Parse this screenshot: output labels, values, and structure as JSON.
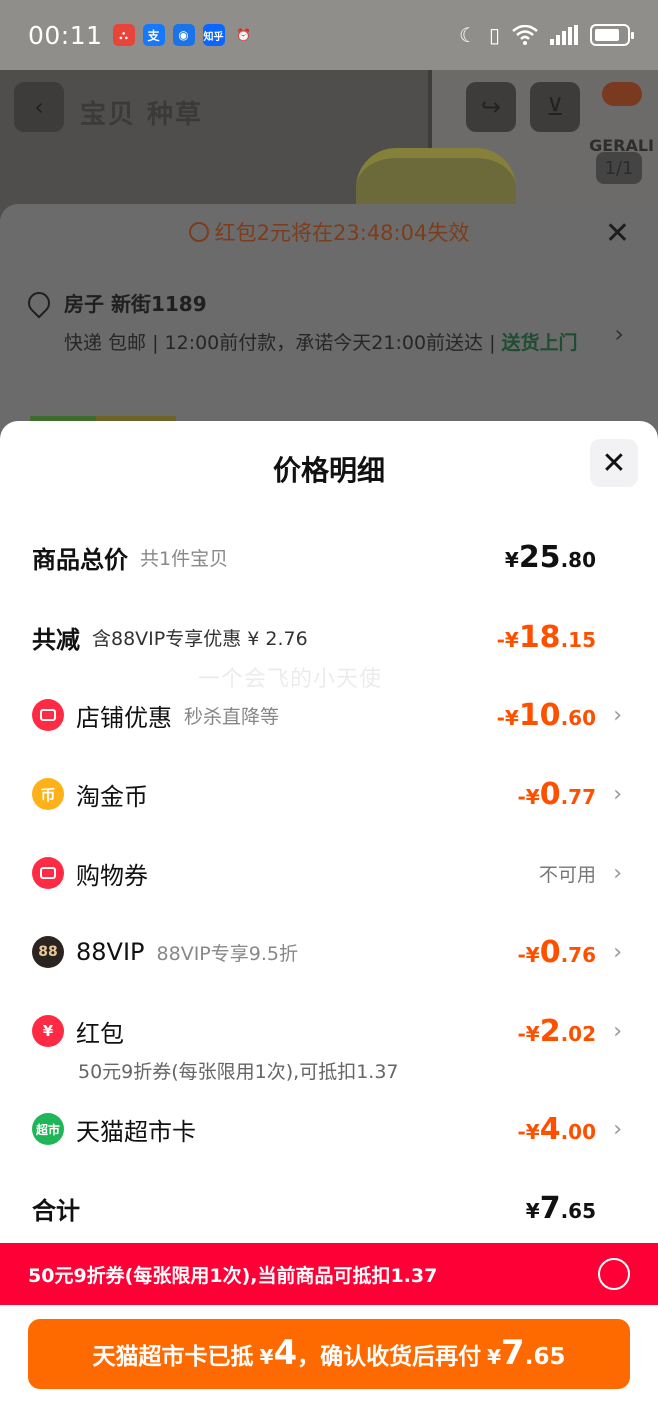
{
  "status_bar": {
    "time": "00:11",
    "apps": [
      {
        "name": "app-icon-1",
        "glyph": "⛬",
        "color": "#e8443a"
      },
      {
        "name": "alipay-icon",
        "glyph": "支",
        "color": "#1677ff"
      },
      {
        "name": "app-icon-3",
        "glyph": "◉",
        "color": "#1a73e8"
      },
      {
        "name": "zhihu-icon",
        "glyph": "知乎",
        "color": "#0a66ff"
      },
      {
        "name": "alarm-icon",
        "glyph": "⏰",
        "color": "transparent"
      }
    ]
  },
  "product_header": {
    "tabs": "宝贝 种草",
    "brand": "GERALI",
    "image_count": "1/1"
  },
  "order_sheet": {
    "banner": "红包2元将在23:48:04失效",
    "address": "房子 新街1189",
    "delivery_prefix": "快递 包邮 | 12:00前付款，承诺今天21:00前送达 | ",
    "delivery_highlight": "送货上门"
  },
  "price_panel": {
    "title": "价格明细",
    "watermark": "一个会飞的小天使",
    "total": {
      "label": "商品总价",
      "sub": "共1件宝贝",
      "cur": "¥",
      "int": "25",
      "dec": ".80"
    },
    "reduction": {
      "label": "共减",
      "sub": "含88VIP专享优惠 ¥ 2.76",
      "cur": "-¥",
      "int": "18",
      "dec": ".15"
    },
    "items": [
      {
        "icon": "store-coupon-icon",
        "label": "店铺优惠",
        "sub": "秒杀直降等",
        "cur": "-¥",
        "int": "10",
        "dec": ".60"
      },
      {
        "icon": "tao-coin-icon",
        "label": "淘金币",
        "sub": "",
        "cur": "-¥",
        "int": "0",
        "dec": ".77"
      },
      {
        "icon": "shopping-voucher-icon",
        "label": "购物券",
        "sub": "",
        "status": "不可用"
      },
      {
        "icon": "vip88-icon",
        "label": "88VIP",
        "sub": "88VIP专享9.5折",
        "cur": "-¥",
        "int": "0",
        "dec": ".76"
      },
      {
        "icon": "red-packet-icon",
        "label": "红包",
        "sub": "",
        "cur": "-¥",
        "int": "2",
        "dec": ".02",
        "note": "50元9折券(每张限用1次),可抵扣1.37"
      },
      {
        "icon": "tmall-market-card-icon",
        "label": "天猫超市卡",
        "sub": "",
        "cur": "-¥",
        "int": "4",
        "dec": ".00"
      }
    ],
    "sum": {
      "label": "合计",
      "cur": "¥",
      "int": "7",
      "dec": ".65"
    },
    "promo_bar": "50元9折券(每张限用1次),当前商品可抵扣1.37",
    "cta": {
      "prefix": "天猫超市卡已抵",
      "cur1": "¥",
      "amt1": "4",
      "mid": "，确认收货后再付",
      "cur2": "¥",
      "amt2_int": "7",
      "amt2_dec": ".65"
    }
  },
  "colors": {
    "accent": "#ff5000",
    "promo": "#ff0036",
    "cta": "#ff6a00"
  }
}
